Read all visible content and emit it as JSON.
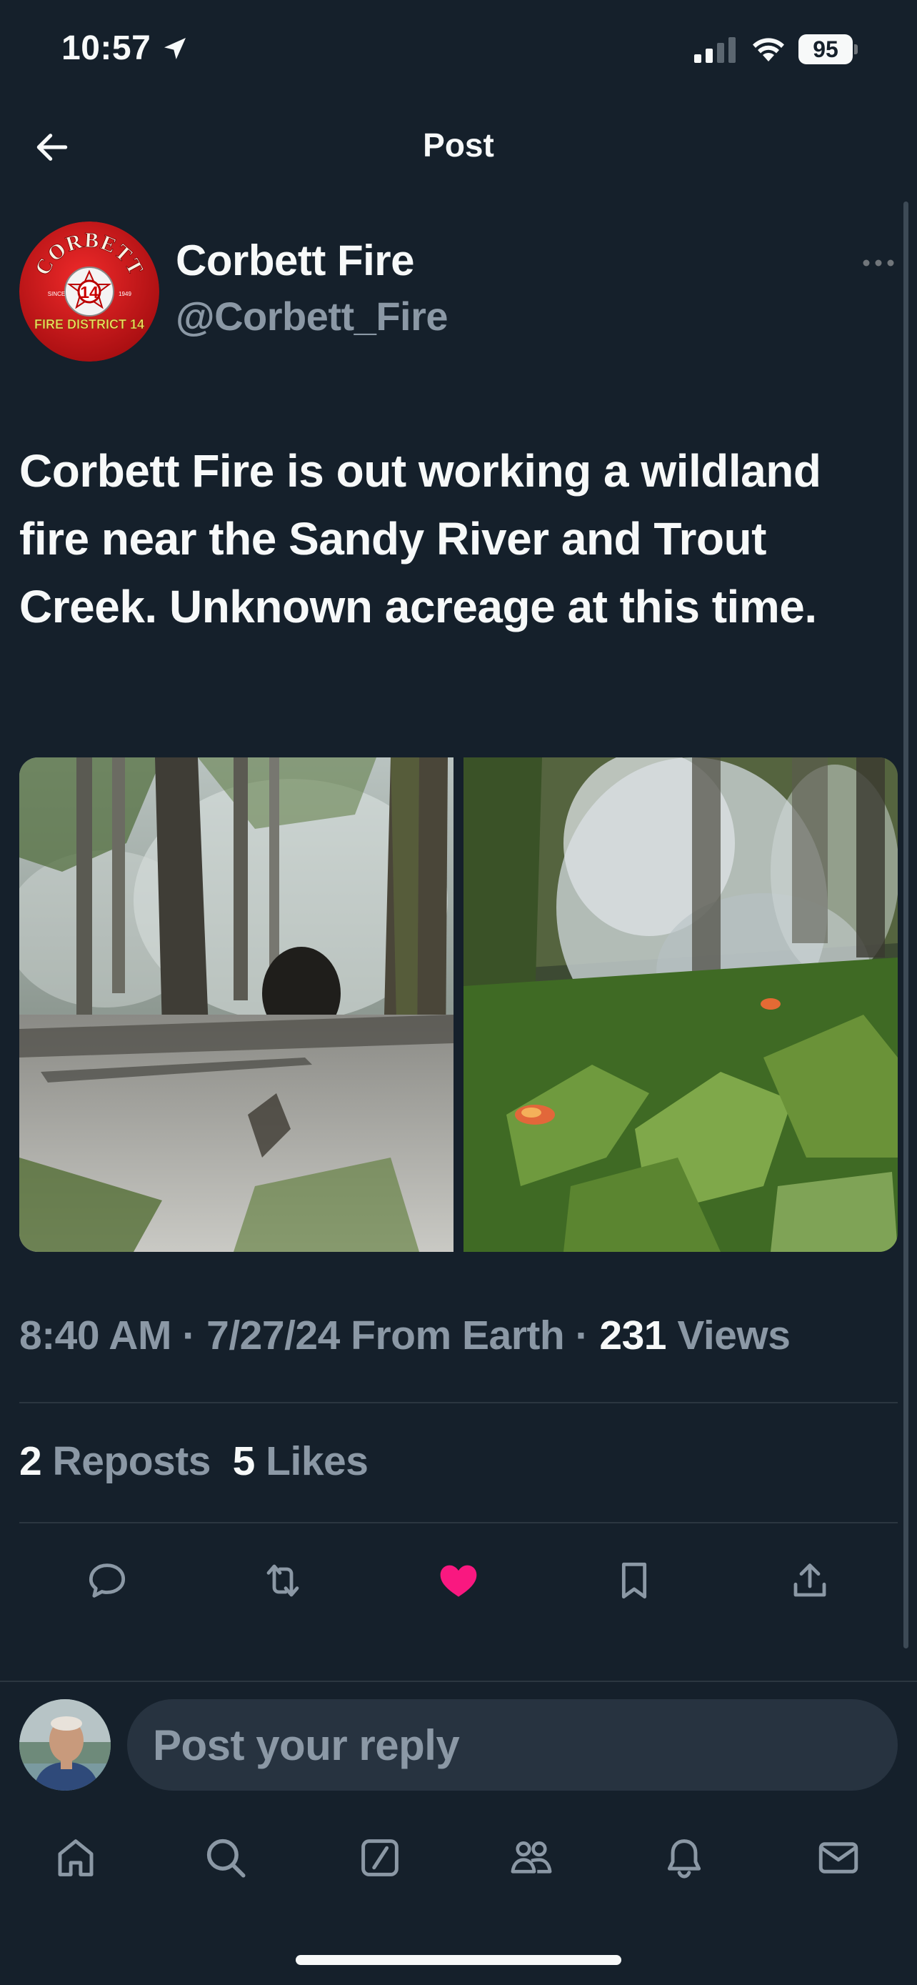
{
  "status_bar": {
    "time": "10:57",
    "battery": "95"
  },
  "header": {
    "title": "Post"
  },
  "post": {
    "author": {
      "name": "Corbett Fire",
      "handle": "@Corbett_Fire"
    },
    "avatar_text": {
      "top": "CORBETT",
      "bottom": "FIRE DISTRICT 14",
      "number": "14",
      "since": "SINCE",
      "year": "1949"
    },
    "text": "Corbett Fire is out working a wildland fire near the Sandy River and Trout Creek. Unknown acreage at this time.",
    "meta": {
      "time": "8:40 AM",
      "date": "7/27/24",
      "source": "From Earth",
      "views_count": "231",
      "views_label": "Views"
    },
    "stats": {
      "reposts_count": "2",
      "reposts_label": "Reposts",
      "likes_count": "5",
      "likes_label": "Likes"
    },
    "liked": true
  },
  "reply": {
    "placeholder": "Post your reply"
  },
  "colors": {
    "background": "#15202b",
    "text": "#f7f9f9",
    "secondary": "#8b98a5",
    "like": "#f91880",
    "divider": "#2b3640"
  },
  "icons": {
    "actions": [
      "reply-icon",
      "repost-icon",
      "like-icon",
      "bookmark-icon",
      "share-icon"
    ],
    "tabs": [
      "home-icon",
      "search-icon",
      "grok-icon",
      "communities-icon",
      "notifications-icon",
      "messages-icon"
    ]
  }
}
